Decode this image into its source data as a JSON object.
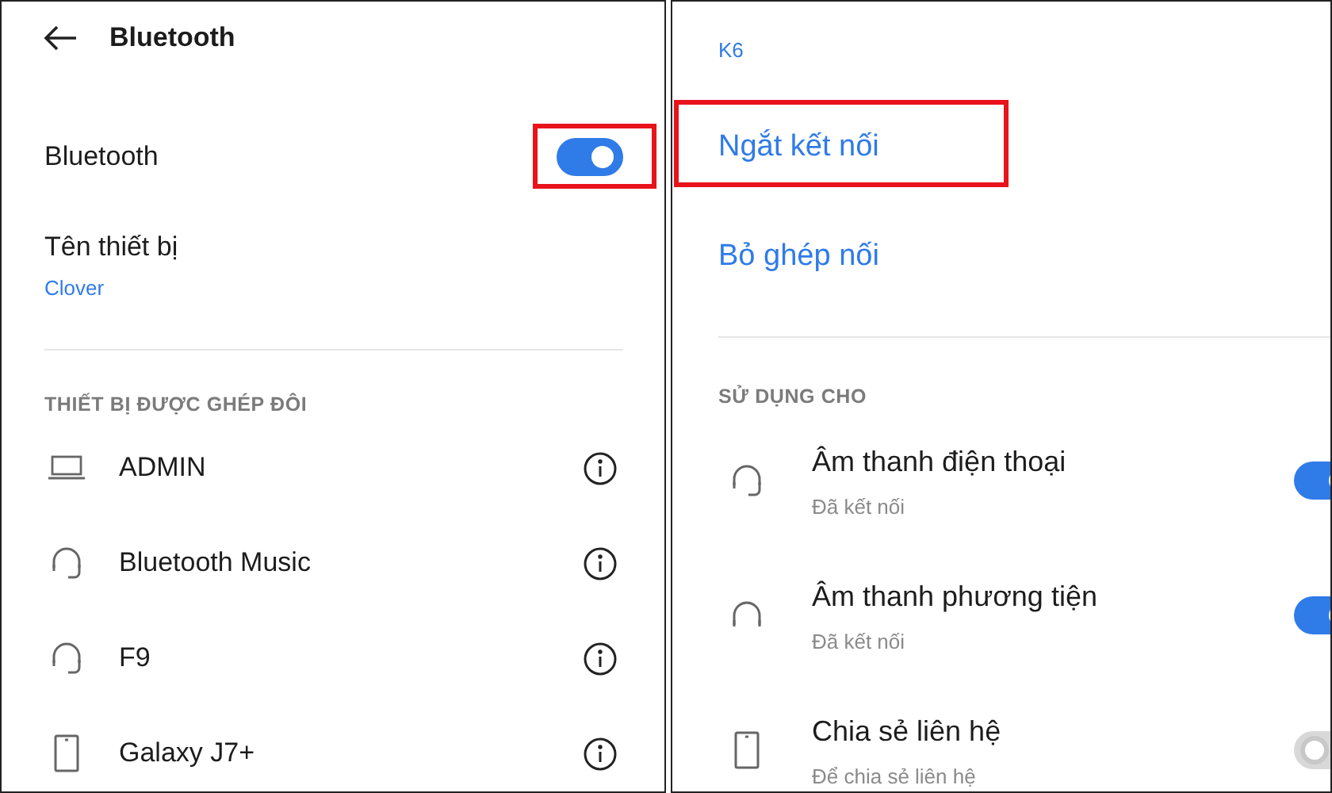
{
  "left": {
    "header": {
      "title": "Bluetooth"
    },
    "bluetooth": {
      "label": "Bluetooth",
      "on": true,
      "highlighted": true
    },
    "device_name": {
      "label": "Tên thiết bị",
      "value": "Clover"
    },
    "paired": {
      "title": "THIẾT BỊ ĐƯỢC GHÉP ĐÔI",
      "devices": [
        {
          "kind": "laptop",
          "name": "ADMIN"
        },
        {
          "kind": "headset",
          "name": "Bluetooth Music"
        },
        {
          "kind": "headset",
          "name": "F9"
        },
        {
          "kind": "phone",
          "name": "Galaxy J7+"
        }
      ]
    }
  },
  "right": {
    "device_name": {
      "value": "K6"
    },
    "actions": [
      {
        "label": "Ngắt kết nối",
        "highlighted": true
      },
      {
        "label": "Bỏ ghép nối",
        "highlighted": false
      }
    ],
    "use_for": {
      "title": "SỬ DỤNG CHO",
      "profiles": [
        {
          "kind": "headset",
          "title": "Âm thanh điện thoại",
          "status": "Đã kết nối",
          "on": true
        },
        {
          "kind": "headphones",
          "title": "Âm thanh phương tiện",
          "status": "Đã kết nối",
          "on": true
        },
        {
          "kind": "phone",
          "title": "Chia sẻ liên hệ",
          "status": "Để chia sẻ liên hệ",
          "on": false
        }
      ]
    }
  }
}
